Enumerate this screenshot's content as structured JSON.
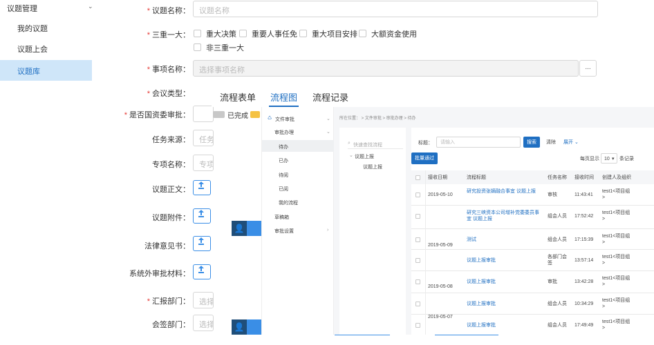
{
  "sidebar": {
    "group": "议题管理",
    "items": [
      "我的议题",
      "议题上会",
      "议题库"
    ]
  },
  "form": {
    "topic_name": {
      "label": "议题名称：",
      "placeholder": "议题名称"
    },
    "three_major": {
      "label": "三重一大：",
      "options": [
        "重大决策",
        "重要人事任免",
        "重大项目安排",
        "大额资金使用",
        "非三重一大"
      ]
    },
    "matter_name": {
      "label": "事项名称：",
      "placeholder": "选择事项名称",
      "btn": "..."
    },
    "meeting_type": {
      "label": "会议类型："
    },
    "sasac_approval": {
      "label": "是否国资委审批："
    },
    "task_source": {
      "label": "任务来源：",
      "placeholder": "任务"
    },
    "special_name": {
      "label": "专项名称：",
      "placeholder": "专项"
    },
    "topic_body": {
      "label": "议题正文：",
      "btn": "上传"
    },
    "topic_attach": {
      "label": "议题附件：",
      "btn": "上传"
    },
    "legal_opinion": {
      "label": "法律意见书：",
      "btn": "上传"
    },
    "external_material": {
      "label": "系统外审批材料：",
      "btn": "上传"
    },
    "report_dept": {
      "label": "汇报部门：",
      "placeholder": "选择"
    },
    "cosign_dept": {
      "label": "会签部门：",
      "placeholder": "选择"
    }
  },
  "flow_tabs": {
    "tabs": [
      "流程表单",
      "流程图",
      "流程记录"
    ],
    "active": 1,
    "legend_done": "已完成",
    "colors": {
      "done": "#c8c8c8",
      "current": "#f5c242"
    }
  },
  "shot": {
    "nav": {
      "header": "文件审批",
      "group": "审批办理",
      "items": [
        "待办",
        "已办",
        "待阅",
        "已阅",
        "我的流程"
      ],
      "draft": "草稿箱",
      "settings": "审批设置"
    },
    "breadcrumb": "所在位置： > 文件审批 > 审批办理 > 待办",
    "tree": {
      "search": "快速查找流程",
      "root": "议题上报",
      "child": "议题上报"
    },
    "grid": {
      "title_label": "标题：",
      "title_placeholder": "请输入",
      "search_btn": "搜索",
      "clear_btn": "清除",
      "expand": "展开",
      "batch_btn": "批量通过",
      "page_size_label": "每页显示",
      "page_size": "10",
      "page_size_suffix": "条记录",
      "columns": [
        "接收日期",
        "流程标题",
        "任务名称",
        "接收时间",
        "创建人及组织"
      ],
      "rows": [
        {
          "date": "2019-05-10",
          "title": "研究投资张嫡融合事宜 议题上报",
          "task": "审核",
          "time": "11:43:41",
          "creator": "test1<项目组>"
        },
        {
          "date": "2019-05-09",
          "title": "研究三峡资本公司增补党委委员事宜 议题上报",
          "task": "组会人员",
          "time": "17:52:42",
          "creator": "test1<项目组>"
        },
        {
          "date": "",
          "title": "测试",
          "task": "组会人员",
          "time": "17:15:39",
          "creator": "test1<项目组>"
        },
        {
          "date": "2019-05-08",
          "title": "议题上报审批",
          "task": "各部门会签",
          "time": "13:57:14",
          "creator": "test1<项目组>"
        },
        {
          "date": "",
          "title": "议题上报审批",
          "task": "审批",
          "time": "13:42:28",
          "creator": "test1<项目组>"
        },
        {
          "date": "2019-05-07",
          "title": "议题上报审批",
          "task": "组会人员",
          "time": "10:34:29",
          "creator": "test1<项目组>"
        },
        {
          "date": "",
          "title": "议题上报审批",
          "task": "组会人员",
          "time": "17:49:49",
          "creator": "test1<项目组>"
        }
      ]
    }
  }
}
